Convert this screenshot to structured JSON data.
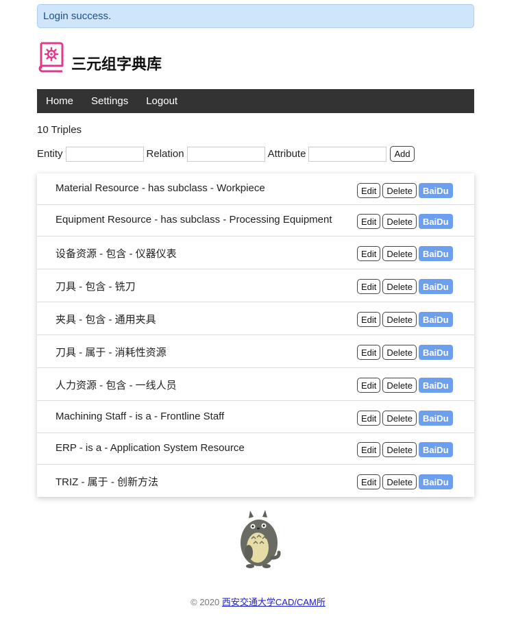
{
  "alert": {
    "message": "Login success."
  },
  "brand": {
    "title": "三元组字典库",
    "icon": "book-gear-icon",
    "icon_color": "#e0398a"
  },
  "nav": {
    "items": [
      {
        "label": "Home"
      },
      {
        "label": "Settings"
      },
      {
        "label": "Logout"
      }
    ]
  },
  "summary": {
    "count_text": "10 Triples"
  },
  "form": {
    "entity_label": "Entity",
    "entity_value": "",
    "relation_label": "Relation",
    "relation_value": "",
    "attribute_label": "Attribute",
    "attribute_value": "",
    "add_label": "Add"
  },
  "triples": [
    {
      "text": "Material Resource - has subclass - Workpiece"
    },
    {
      "text": "Equipment Resource - has subclass - Processing Equipment"
    },
    {
      "text": "设备资源 - 包含 - 仪器仪表"
    },
    {
      "text": "刀具 - 包含 - 铣刀"
    },
    {
      "text": "夹具 - 包含 - 通用夹具"
    },
    {
      "text": "刀具 - 属于 - 消耗性资源"
    },
    {
      "text": "人力资源 - 包含 - 一线人员"
    },
    {
      "text": "Machining Staff - is a - Frontline Staff"
    },
    {
      "text": "ERP - is a - Application System Resource"
    },
    {
      "text": "TRIZ - 属于 - 创新方法"
    }
  ],
  "row_actions": {
    "edit_label": "Edit",
    "delete_label": "Delete",
    "baidu_label": "BaiDu"
  },
  "mascot": {
    "icon": "totoro-mascot-icon"
  },
  "footer": {
    "copyright": "© 2020",
    "link_text": "西安交通大学CAD/CAM所"
  },
  "colors": {
    "navbar": "#333333",
    "alert_bg": "#cfe5fb",
    "baidu_button": "#6c9ff0"
  }
}
